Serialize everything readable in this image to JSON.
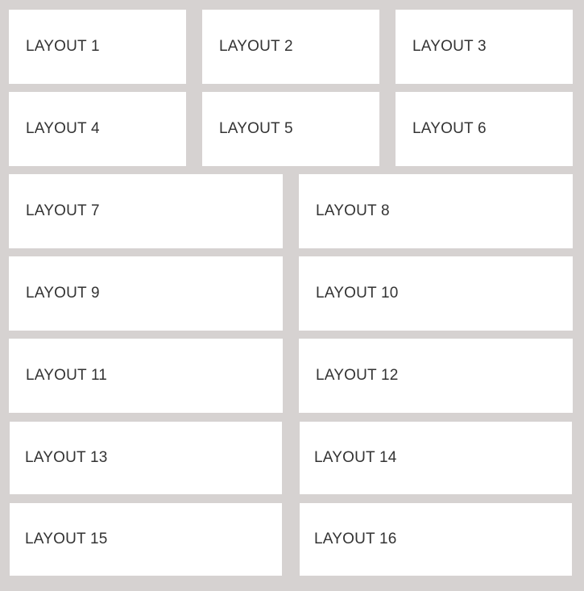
{
  "layouts": [
    {
      "label": "LAYOUT 1"
    },
    {
      "label": "LAYOUT 2"
    },
    {
      "label": "LAYOUT 3"
    },
    {
      "label": "LAYOUT 4"
    },
    {
      "label": "LAYOUT 5"
    },
    {
      "label": "LAYOUT 6"
    },
    {
      "label": "LAYOUT 7"
    },
    {
      "label": "LAYOUT 8"
    },
    {
      "label": "LAYOUT 9"
    },
    {
      "label": "LAYOUT 10"
    },
    {
      "label": "LAYOUT 11"
    },
    {
      "label": "LAYOUT 12"
    },
    {
      "label": "LAYOUT 13"
    },
    {
      "label": "LAYOUT 14"
    },
    {
      "label": "LAYOUT 15"
    },
    {
      "label": "LAYOUT 16"
    }
  ]
}
